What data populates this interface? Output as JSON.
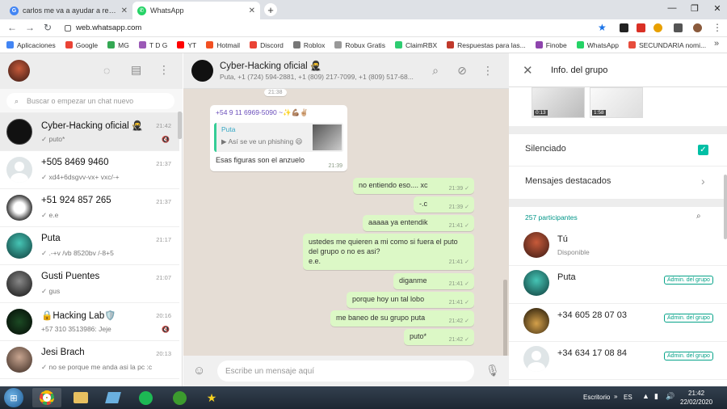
{
  "browser": {
    "tabs": [
      {
        "title": "carlos me va a ayudar a recuperar",
        "favicon": "google-icon",
        "color": "#4285f4"
      },
      {
        "title": "WhatsApp",
        "favicon": "whatsapp-icon",
        "color": "#25d366"
      }
    ],
    "url": "web.whatsapp.com",
    "bookmarks": [
      {
        "label": "Aplicaciones",
        "color": "#4285f4"
      },
      {
        "label": "Google",
        "color": "#ea4335"
      },
      {
        "label": "MG",
        "color": "#34a853"
      },
      {
        "label": "T D G",
        "color": "#9b59b6"
      },
      {
        "label": "YT",
        "color": "#ff0000"
      },
      {
        "label": "Hotmail",
        "color": "#f25022"
      },
      {
        "label": "Discord",
        "color": "#ea4335"
      },
      {
        "label": "Roblox",
        "color": "#777777"
      },
      {
        "label": "Robux Gratis",
        "color": "#999999"
      },
      {
        "label": "ClaimRBX",
        "color": "#2ecc71"
      },
      {
        "label": "Respuestas para las...",
        "color": "#c0392b"
      },
      {
        "label": "Finobe",
        "color": "#8e44ad"
      },
      {
        "label": "WhatsApp",
        "color": "#25d366"
      },
      {
        "label": "SECUNDARIA nomi...",
        "color": "#e74c3c"
      }
    ]
  },
  "sidebar": {
    "search_placeholder": "Buscar o empezar un chat nuevo",
    "chats": [
      {
        "name": "Cyber-Hacking oficial 🥷",
        "time": "21:42",
        "preview": "✓ puto*",
        "muted": true
      },
      {
        "name": "+505 8469 9460",
        "time": "21:37",
        "preview": "✓ xd4+6dsgvv-vx+ vxc/-+",
        "muted": false
      },
      {
        "name": "+51 924 857 265",
        "time": "21:37",
        "preview": "✓ e.e",
        "muted": false
      },
      {
        "name": "Puta",
        "time": "21:17",
        "preview": "✓ .-+v /vb 8520bv /-8+5",
        "muted": false
      },
      {
        "name": "Gusti Puentes",
        "time": "21:07",
        "preview": "✓ gus",
        "muted": false
      },
      {
        "name": "🔒Hacking Lab🛡️",
        "time": "20:16",
        "preview": "+57 310 3513986: Jeje",
        "muted": true
      },
      {
        "name": "Jesi Brach",
        "time": "20:13",
        "preview": "✓ no se porque me anda asi la pc :c",
        "muted": false
      }
    ]
  },
  "chat": {
    "name": "Cyber-Hacking oficial 🥷",
    "members": "Puta, +1 (724) 594-2881, +1 (809) 217-7099, +1 (809) 517-68...",
    "top_time": "21:38",
    "incoming": {
      "sender": "+54 9 11 6969-5090",
      "sender_suffix": "~✨💪🏽✌🏼",
      "quote_author": "Puta",
      "quote_text": "Así se ve un phishing 😄",
      "text": "Esas figuras  son el anzuelo",
      "time": "21:39"
    },
    "outgoing": [
      {
        "text": "no entiendo eso.... xc",
        "time": "21:39"
      },
      {
        "text": "-.c",
        "time": "21:39"
      },
      {
        "text": "aaaaa ya entendik",
        "time": "21:41"
      },
      {
        "text": "ustedes me quieren a mi como si fuera el puto del grupo o no es asi?\ne.e.",
        "time": "21:41"
      },
      {
        "text": "diganme",
        "time": "21:41"
      },
      {
        "text": "porque hoy un tal lobo",
        "time": "21:41"
      },
      {
        "text": "me baneo de su grupo puta",
        "time": "21:42"
      },
      {
        "text": "puto*",
        "time": "21:42"
      }
    ],
    "compose_placeholder": "Escribe un mensaje aquí"
  },
  "group_info": {
    "title": "Info. del grupo",
    "media": [
      {
        "duration": "0:13"
      },
      {
        "duration": "1:58"
      }
    ],
    "muted_label": "Silenciado",
    "starred_label": "Mensajes destacados",
    "participants_count": "257 participantes",
    "participants": [
      {
        "name": "Tú",
        "status": "Disponible",
        "admin": false
      },
      {
        "name": "Puta",
        "status": "",
        "admin": true
      },
      {
        "name": "+34 605 28 07 03",
        "status": "",
        "admin": true
      },
      {
        "name": "+34 634 17 08 84",
        "status": "",
        "admin": true
      }
    ],
    "admin_label": "Admin. del grupo"
  },
  "taskbar": {
    "desktop_label": "Escritorio",
    "lang": "ES",
    "time": "21:42",
    "date": "22/02/2020"
  }
}
